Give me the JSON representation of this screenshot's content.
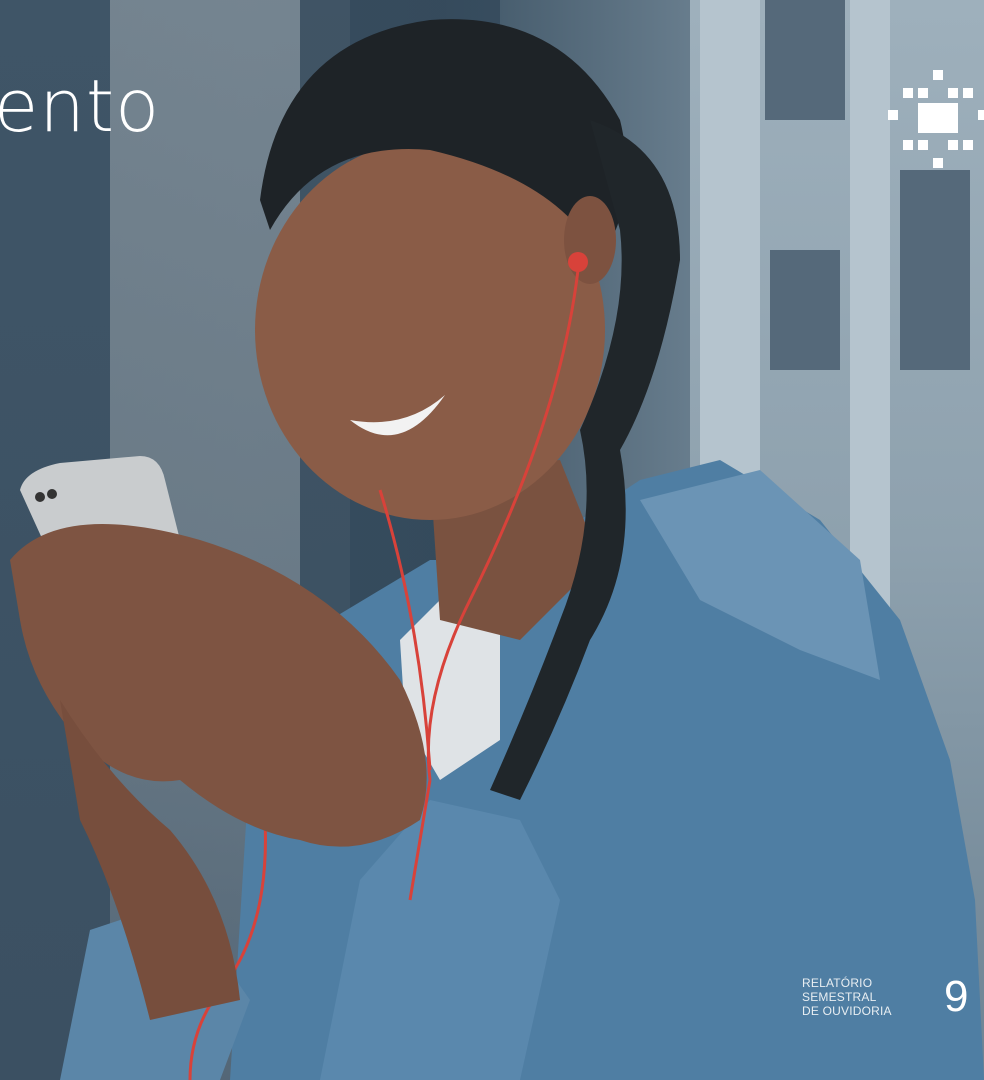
{
  "page": {
    "heading": "ento",
    "footer": {
      "report_label": "RELATÓRIO\nSEMESTRAL\nDE OUVIDORIA",
      "page_number": "9"
    }
  },
  "photo": {
    "subject": "woman-with-phone-and-earphones",
    "accent_color": "#d8423a"
  },
  "brand": {
    "icon": "cross-pattern-logo"
  }
}
